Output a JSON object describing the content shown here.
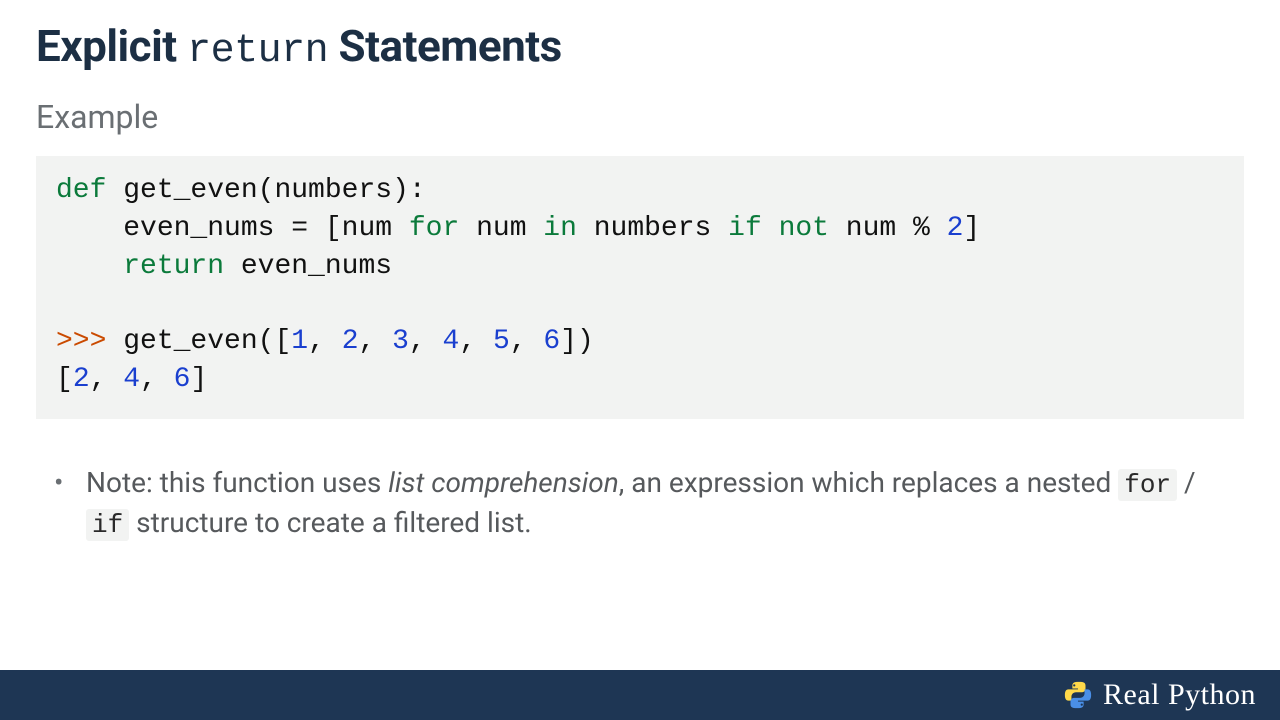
{
  "title": {
    "part1": "Explicit",
    "code": "return",
    "part2": "Statements"
  },
  "subtitle": "Example",
  "code": {
    "l1": {
      "def": "def",
      "name": " get_even(numbers):"
    },
    "l2": {
      "indent": "    even_nums = [num ",
      "for": "for",
      "mid1": " num ",
      "in": "in",
      "mid2": " numbers ",
      "if": "if",
      "sp1": " ",
      "not": "not",
      "mid3": " num % ",
      "two": "2",
      "close": "]"
    },
    "l3": {
      "indent": "    ",
      "return": "return",
      "rest": " even_nums"
    },
    "l5": {
      "prompt": ">>>",
      "call1": " get_even([",
      "n1": "1",
      "c1": ", ",
      "n2": "2",
      "c2": ", ",
      "n3": "3",
      "c3": ", ",
      "n4": "4",
      "c4": ", ",
      "n5": "5",
      "c5": ", ",
      "n6": "6",
      "close": "])"
    },
    "l6": {
      "open": "[",
      "n1": "2",
      "c1": ", ",
      "n2": "4",
      "c2": ", ",
      "n3": "6",
      "close": "]"
    }
  },
  "bullet": {
    "p1": "Note: this function uses ",
    "em": "list comprehension",
    "p2": ", an expression which replaces a nested ",
    "for": "for",
    "slash": " / ",
    "if": "if",
    "p3": " structure to create a filtered list."
  },
  "footer": {
    "brand": "Real Python"
  }
}
